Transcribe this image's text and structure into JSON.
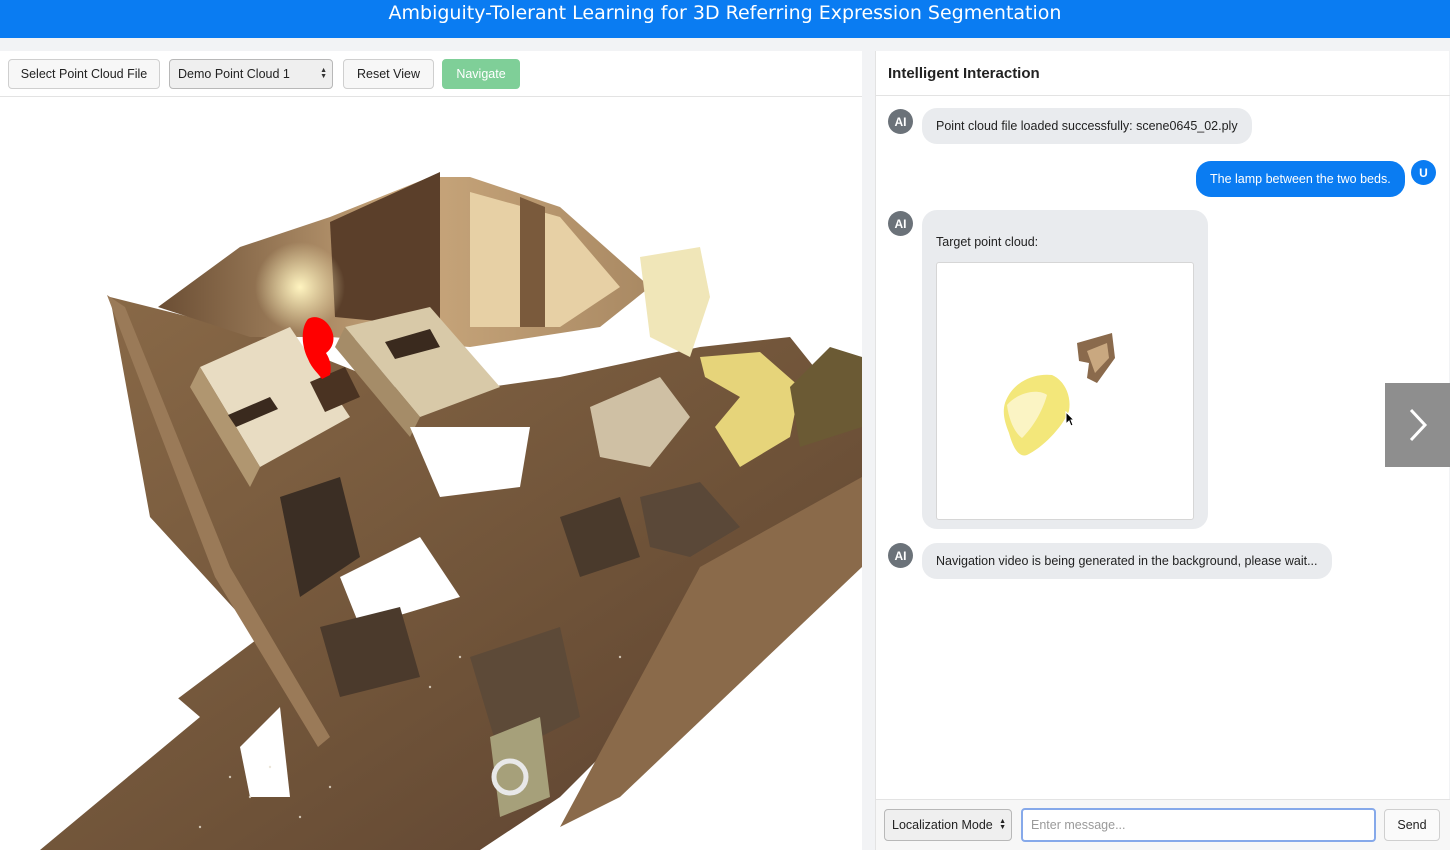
{
  "header": {
    "title": "Ambiguity-Tolerant Learning for 3D Referring Expression Segmentation"
  },
  "toolbar": {
    "select_file_label": "Select Point Cloud File",
    "point_cloud_selected": "Demo Point Cloud 1",
    "reset_label": "Reset View",
    "navigate_label": "Navigate"
  },
  "chat": {
    "title": "Intelligent Interaction",
    "messages": [
      {
        "sender": "AI",
        "text": "Point cloud file loaded successfully: scene0645_02.ply"
      },
      {
        "sender": "U",
        "text": "The lamp between the two beds."
      },
      {
        "sender": "AI",
        "text": "Target point cloud:"
      },
      {
        "sender": "AI",
        "text": "Navigation video is being generated in the background, please wait..."
      }
    ]
  },
  "input_bar": {
    "mode": "Localization Mode",
    "placeholder": "Enter message...",
    "send_label": "Send"
  },
  "colors": {
    "accent": "#0a7cf2",
    "navigate": "#7fcf98",
    "highlight": "#ff0000"
  },
  "icons": [
    "chevron-right-icon",
    "select-arrows-icon",
    "cursor-icon"
  ]
}
